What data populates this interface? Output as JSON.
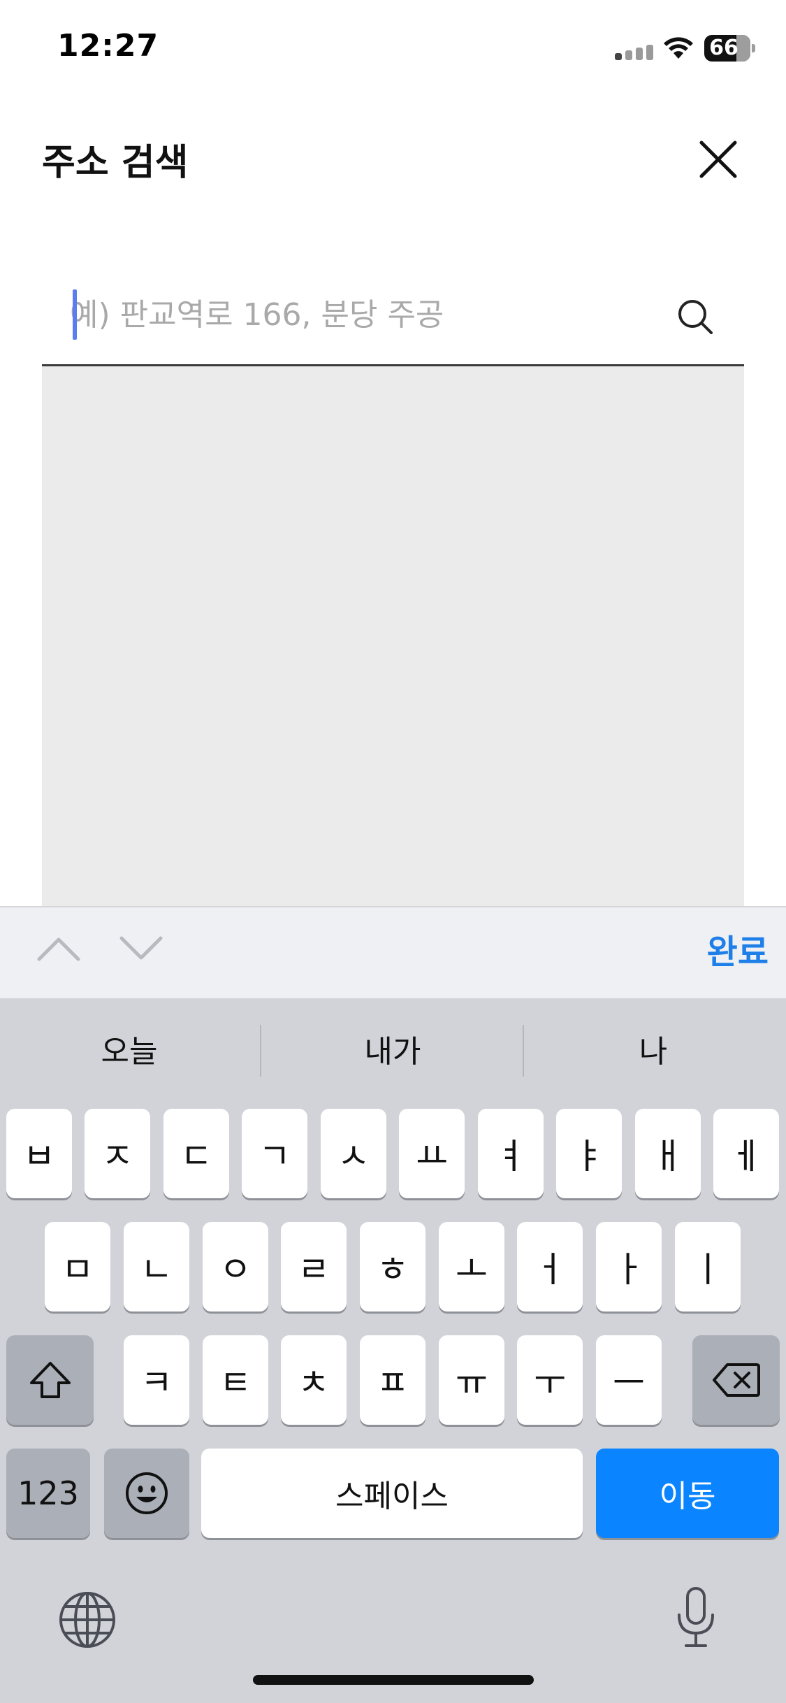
{
  "status_bar": {
    "time": "12:27",
    "battery_level": "66"
  },
  "header": {
    "title": "주소 검색",
    "close_icon": "close-icon"
  },
  "search": {
    "value": "",
    "placeholder": "예) 판교역로 166, 분당 주공",
    "icon": "search-icon"
  },
  "accessory_bar": {
    "done_label": "완료",
    "prev_icon": "chevron-up-icon",
    "next_icon": "chevron-down-icon"
  },
  "keyboard": {
    "suggestions": [
      "오늘",
      "내가",
      "나"
    ],
    "row1": [
      "ㅂ",
      "ㅈ",
      "ㄷ",
      "ㄱ",
      "ㅅ",
      "ㅛ",
      "ㅕ",
      "ㅑ",
      "ㅐ",
      "ㅔ"
    ],
    "row2": [
      "ㅁ",
      "ㄴ",
      "ㅇ",
      "ㄹ",
      "ㅎ",
      "ㅗ",
      "ㅓ",
      "ㅏ",
      "ㅣ"
    ],
    "row3": [
      "ㅋ",
      "ㅌ",
      "ㅊ",
      "ㅍ",
      "ㅠ",
      "ㅜ",
      "ㅡ"
    ],
    "numbers_label": "123",
    "space_label": "스페이스",
    "go_label": "이동"
  },
  "colors": {
    "accent": "#0a84ff",
    "done_text": "#1f7fe8",
    "results_bg": "#ebebeb",
    "keyboard_bg": "#d1d3d9"
  }
}
